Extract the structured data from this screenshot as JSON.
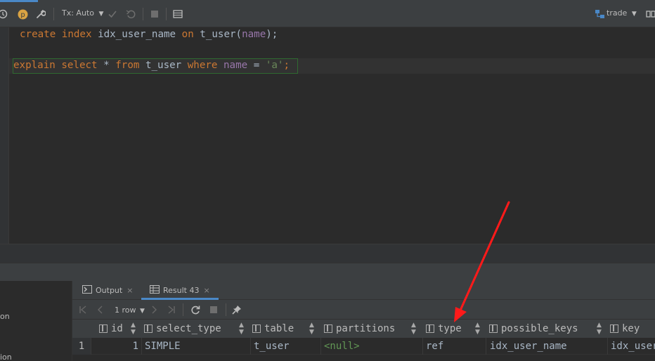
{
  "toolbar": {
    "tx_label": "Tx: Auto",
    "datasource_label": "trade"
  },
  "editor": {
    "line1": {
      "kw1": "create",
      "kw2": "index",
      "index_name": "idx_user_name",
      "kw3": "on",
      "table": "t_user",
      "paren_open": "(",
      "column": "name",
      "paren_close": ");"
    },
    "line2": {
      "kw1": "explain",
      "kw2": "select",
      "star": "*",
      "kw3": "from",
      "table": "t_user",
      "kw4": "where",
      "column": "name",
      "op": "=",
      "literal": "'a'",
      "semi": ";"
    }
  },
  "left_panel": {
    "text1": "on",
    "text2": "ion"
  },
  "results": {
    "tabs": [
      {
        "label": "Output"
      },
      {
        "label": "Result 43"
      }
    ],
    "row_count": "1 row",
    "columns": [
      "id",
      "select_type",
      "table",
      "partitions",
      "type",
      "possible_keys",
      "key"
    ],
    "rows": [
      {
        "row_number": "1",
        "id": "1",
        "select_type": "SIMPLE",
        "table": "t_user",
        "partitions": "<null>",
        "type": "ref",
        "possible_keys": "idx_user_name",
        "key": "idx_user_name"
      }
    ]
  },
  "colors": {
    "accent": "#4a88c7",
    "keyword": "#cc7832",
    "null_value": "#629755",
    "arrow": "#ff1a1a"
  },
  "icons": {
    "history": "history-icon",
    "profile": "profile-icon",
    "settings": "wrench-icon",
    "commit": "check-icon",
    "rollback": "rollback-icon",
    "stop": "stop-icon",
    "table": "table-icon",
    "datasource": "datasource-icon",
    "output": "output-icon",
    "pin": "pin-icon"
  }
}
